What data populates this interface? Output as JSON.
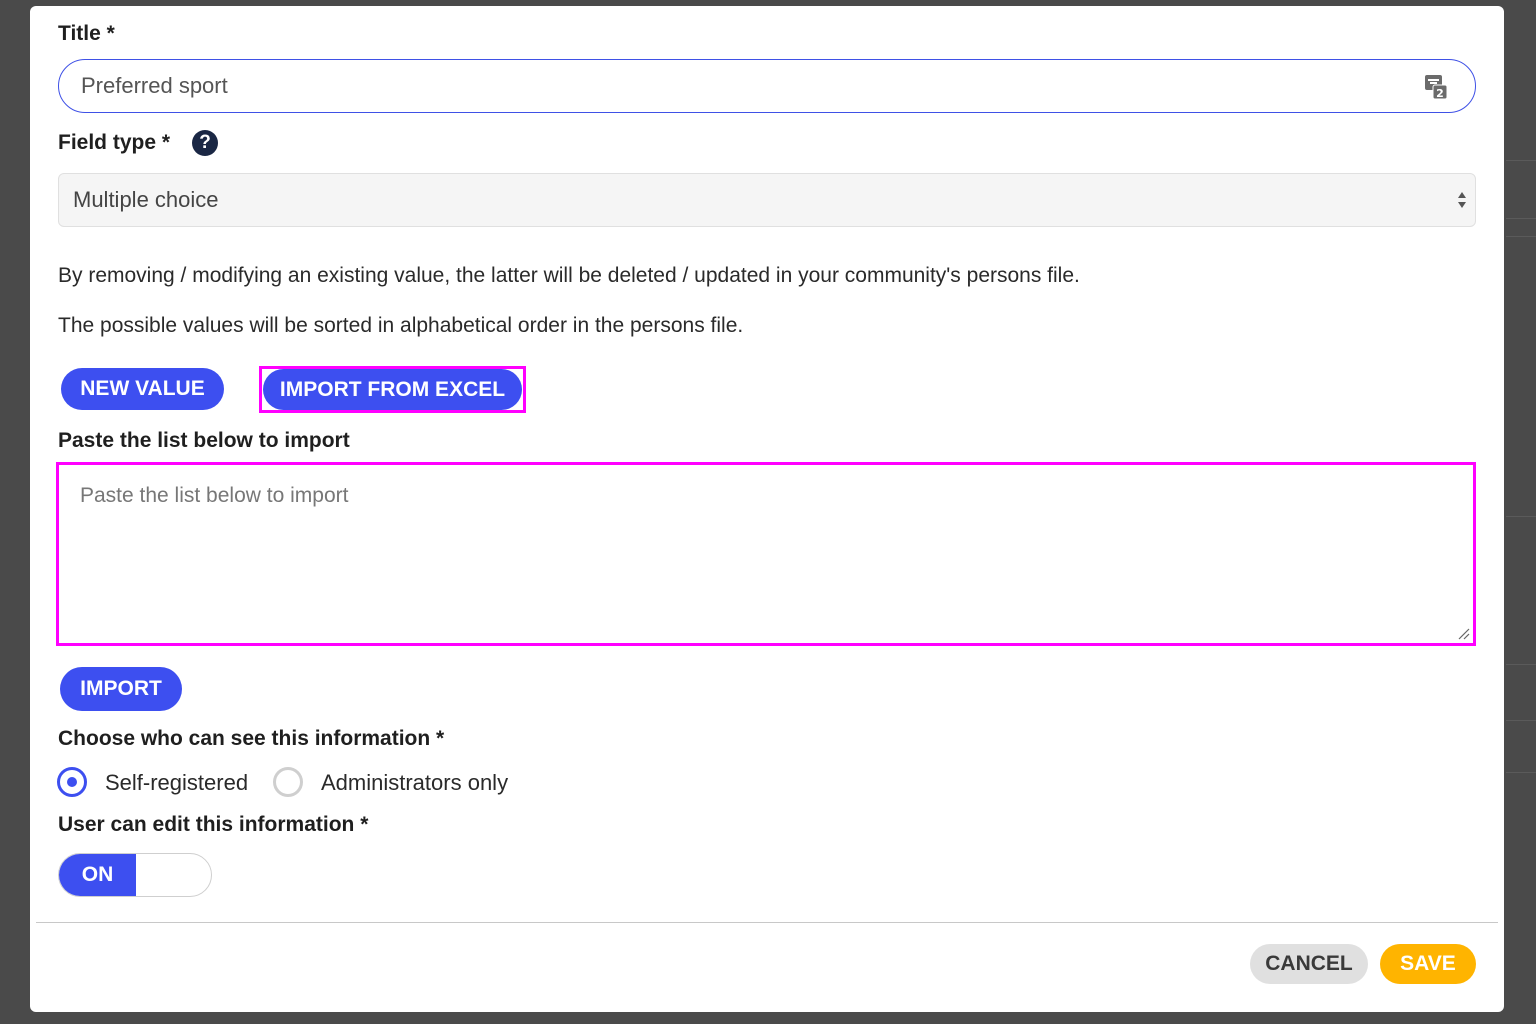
{
  "form": {
    "title_label": "Title *",
    "title_value": "Preferred sport",
    "field_type_label": "Field type *",
    "help_glyph": "?",
    "field_type_value": "Multiple choice",
    "info_line_1": "By removing / modifying an existing value, the latter will be deleted / updated in your community's persons file.",
    "info_line_2": "The possible values will be sorted in alphabetical order in the persons file."
  },
  "values_actions": {
    "new_value_label": "NEW VALUE",
    "import_excel_label": "IMPORT FROM EXCEL"
  },
  "import": {
    "paste_label": "Paste the list below to import",
    "paste_placeholder": "Paste the list below to import",
    "import_label": "IMPORT"
  },
  "visibility": {
    "label": "Choose who can see this information *",
    "options": [
      {
        "label": "Self-registered",
        "selected": true
      },
      {
        "label": "Administrators only",
        "selected": false
      }
    ]
  },
  "editable": {
    "label": "User can edit this information *",
    "toggle_label": "ON",
    "toggle_state": true
  },
  "footer": {
    "cancel_label": "CANCEL",
    "save_label": "SAVE"
  },
  "icons": {
    "translate": "translate-icon",
    "help": "help-icon",
    "select_arrows": "sort-arrows-icon",
    "resize": "resize-grip-icon"
  },
  "colors": {
    "accent": "#3d4ff0",
    "save": "#ffb400",
    "highlight": "#ff00ff",
    "backdrop": "#4a4a4a"
  }
}
